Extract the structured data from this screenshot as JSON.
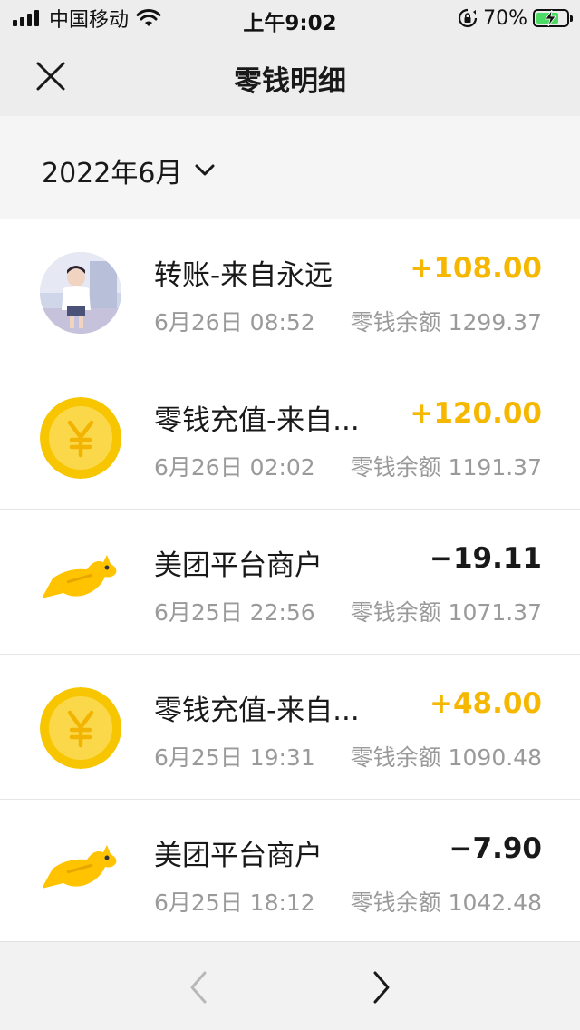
{
  "status_bar": {
    "carrier": "中国移动",
    "time": "上午9:02",
    "battery_percent": "70%",
    "icons": [
      "signal-icon",
      "wifi-icon",
      "orientation-lock-icon",
      "battery-charging-icon"
    ]
  },
  "nav": {
    "title": "零钱明细",
    "close_icon": "close-icon"
  },
  "filter": {
    "month": "2022年6月",
    "chevron_icon": "chevron-down-icon"
  },
  "transactions": [
    {
      "title": "转账-来自永远",
      "amount": "+108.00",
      "time": "6月26日 08:52",
      "balance": "零钱余额 1299.37",
      "avatar": "user-photo",
      "direction": "income"
    },
    {
      "title": "零钱充值-来自...",
      "amount": "+120.00",
      "time": "6月26日 02:02",
      "balance": "零钱余额 1191.37",
      "avatar": "yuan-coin-icon",
      "direction": "income"
    },
    {
      "title": "美团平台商户",
      "amount": "−19.11",
      "time": "6月25日 22:56",
      "balance": "零钱余额 1071.37",
      "avatar": "meituan-kangaroo-logo",
      "direction": "expense"
    },
    {
      "title": "零钱充值-来自...",
      "amount": "+48.00",
      "time": "6月25日 19:31",
      "balance": "零钱余额 1090.48",
      "avatar": "yuan-coin-icon",
      "direction": "income"
    },
    {
      "title": "美团平台商户",
      "amount": "−7.90",
      "time": "6月25日 18:12",
      "balance": "零钱余额 1042.48",
      "avatar": "meituan-kangaroo-logo",
      "direction": "expense"
    }
  ],
  "pager": {
    "prev_icon": "chevron-left-icon",
    "next_icon": "chevron-right-icon"
  },
  "colors": {
    "income": "#f5b700",
    "expense": "#191919",
    "muted": "#9a9a9a",
    "coin": "#f7c600"
  }
}
